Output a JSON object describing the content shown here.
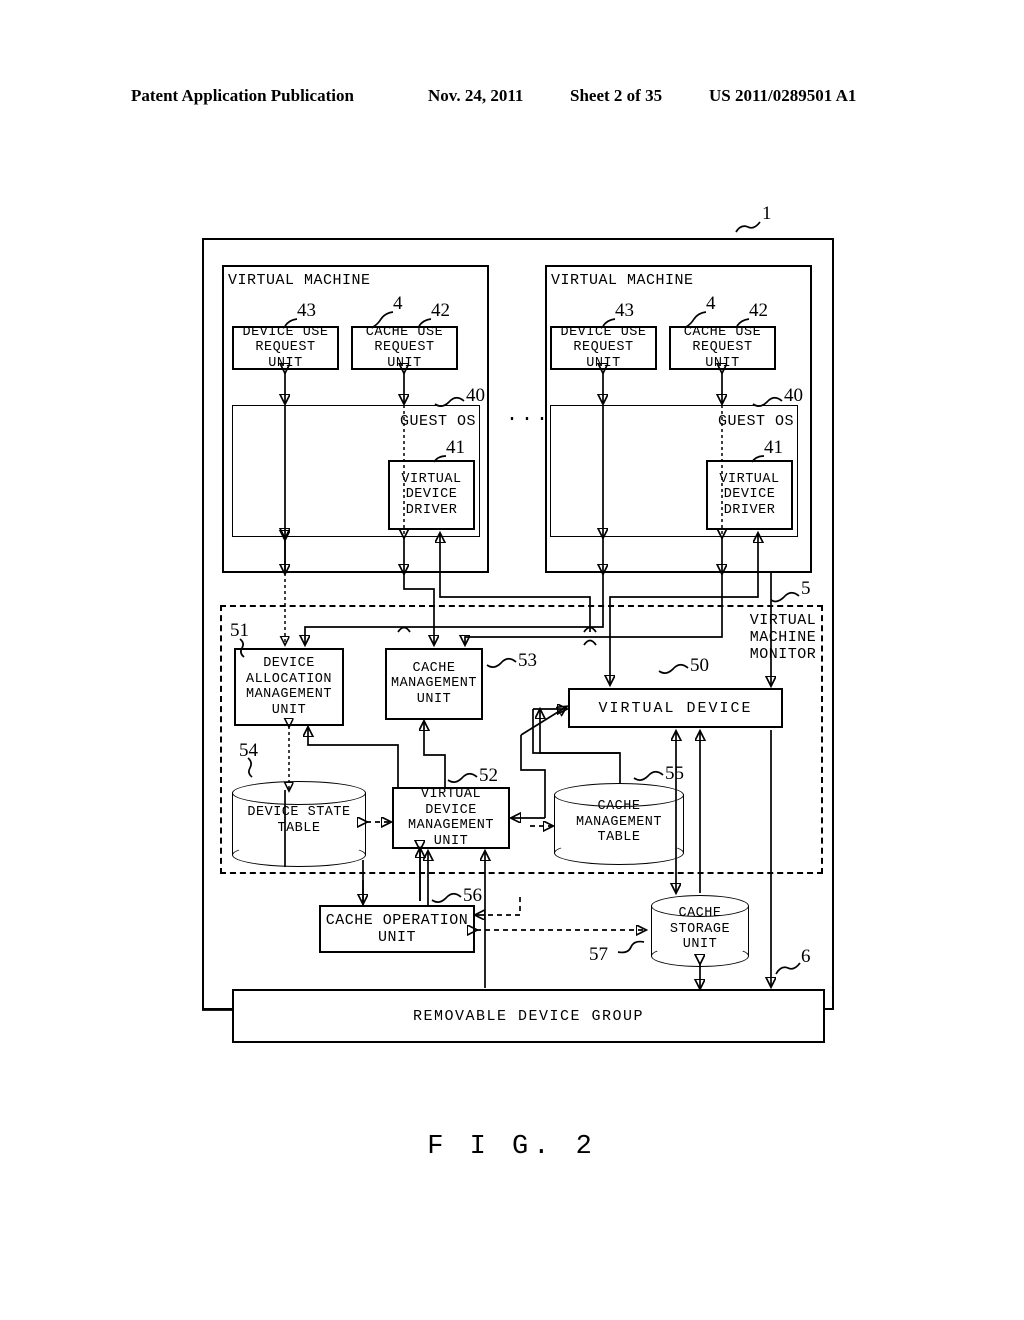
{
  "header": {
    "title": "Patent Application Publication",
    "date": "Nov. 24, 2011",
    "sheet": "Sheet 2 of 35",
    "number": "US 2011/0289501 A1"
  },
  "figure": {
    "caption": "F I G.  2"
  },
  "refs": {
    "system": "1",
    "vm": "4",
    "guest_os": "40",
    "virtual_device_driver": "41",
    "cache_use_request_unit": "42",
    "device_use_request_unit": "43",
    "vmm": "5",
    "virtual_device": "50",
    "device_allocation_management_unit": "51",
    "virtual_device_management_unit": "52",
    "cache_management_unit": "53",
    "device_state_table": "54",
    "cache_management_table": "55",
    "cache_operation_unit": "56",
    "cache_storage_unit": "57",
    "removable_device_group": "6"
  },
  "blocks": {
    "virtual_machine": "VIRTUAL MACHINE",
    "device_use_request_unit": "DEVICE USE\nREQUEST UNIT",
    "cache_use_request_unit": "CACHE USE\nREQUEST UNIT",
    "guest_os": "GUEST OS",
    "virtual_device_driver": "VIRTUAL\nDEVICE\nDRIVER",
    "vmm": "VIRTUAL\nMACHINE\nMONITOR",
    "device_allocation_management_unit": "DEVICE\nALLOCATION\nMANAGEMENT\nUNIT",
    "cache_management_unit": "CACHE\nMANAGEMENT\nUNIT",
    "virtual_device": "VIRTUAL DEVICE",
    "device_state_table": "DEVICE STATE\nTABLE",
    "virtual_device_management_unit": "VIRTUAL DEVICE\nMANAGEMENT\nUNIT",
    "cache_management_table": "CACHE\nMANAGEMENT\nTABLE",
    "cache_operation_unit": "CACHE OPERATION\nUNIT",
    "cache_storage_unit": "CACHE\nSTORAGE\nUNIT",
    "removable_device_group": "REMOVABLE DEVICE GROUP",
    "ellipsis": "..."
  },
  "colors": {
    "ink": "#000000",
    "paper": "#ffffff"
  }
}
